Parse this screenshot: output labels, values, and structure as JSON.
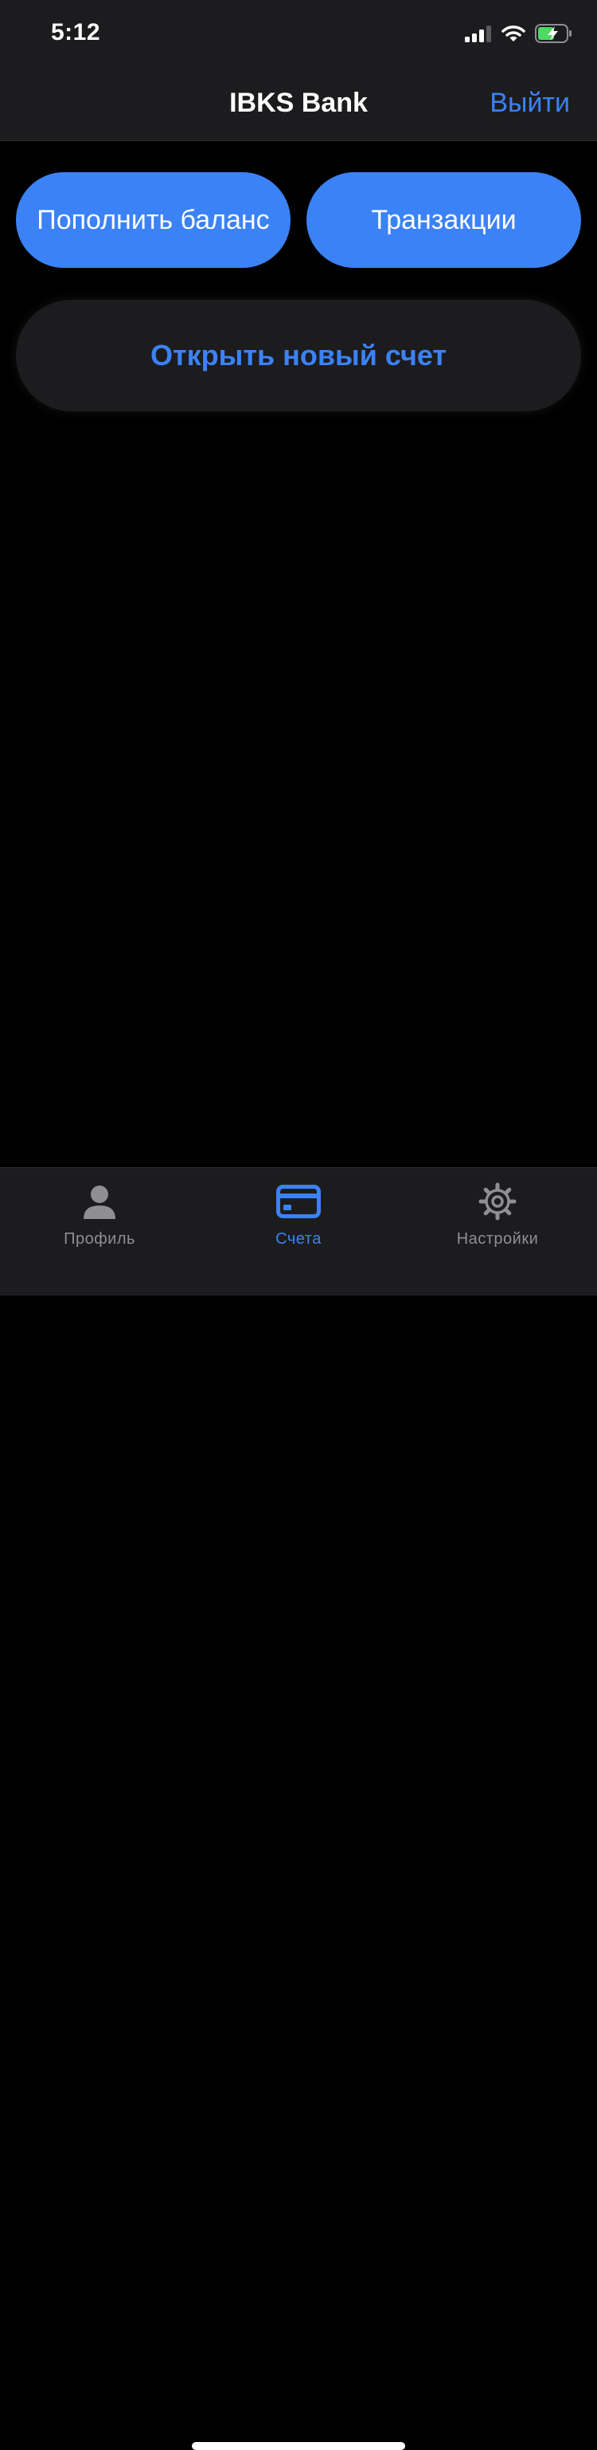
{
  "status_bar": {
    "time": "5:12"
  },
  "nav": {
    "title": "IBKS Bank",
    "logout_label": "Выйти"
  },
  "actions": {
    "topup_label": "Пополнить баланс",
    "transactions_label": "Транзакции",
    "open_account_label": "Открыть новый счет"
  },
  "tabs": [
    {
      "label": "Профиль",
      "icon": "person-icon",
      "active": false
    },
    {
      "label": "Счета",
      "icon": "credit-card-icon",
      "active": true
    },
    {
      "label": "Настройки",
      "icon": "gear-icon",
      "active": false
    }
  ],
  "colors": {
    "accent": "#3b82f6",
    "background": "#000000",
    "bar_background": "#1c1c1e",
    "inactive_tab": "#8e8e93",
    "battery_charging": "#4cd964"
  }
}
